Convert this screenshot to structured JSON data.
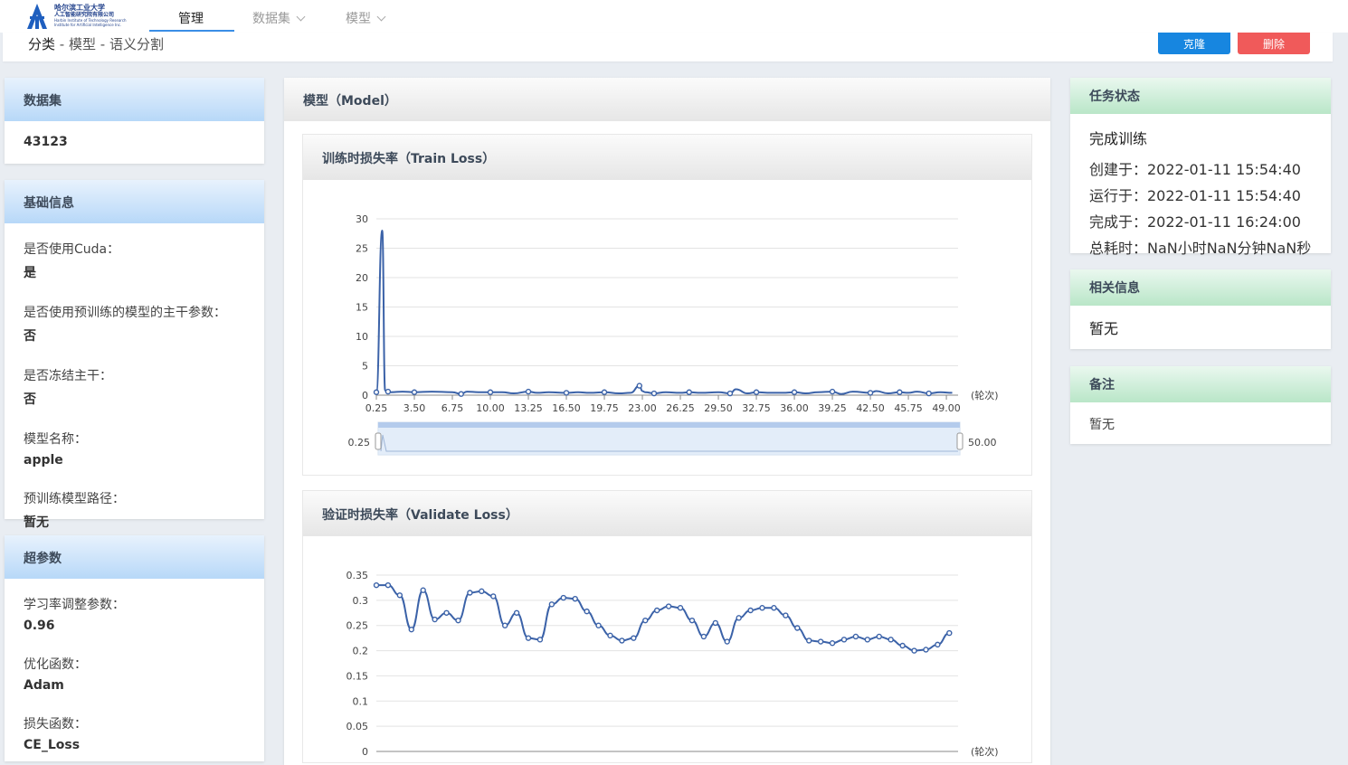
{
  "header": {
    "logo_line1": "哈尔滨工业大学",
    "logo_line2": "人工智能研究院有限公司",
    "logo_line3": "Harbin Institute of Technology Research",
    "logo_line4": "Institute for Artificial Intelligence Inc.",
    "nav": [
      {
        "label": "管理"
      },
      {
        "label": "数据集"
      },
      {
        "label": "模型"
      }
    ],
    "breadcrumb": {
      "root": "分类",
      "sep": " - ",
      "mid": "模型",
      "leaf": "语义分割"
    },
    "clone_label": "克隆",
    "delete_label": "删除"
  },
  "left": {
    "dataset": {
      "title": "数据集",
      "value": "43123"
    },
    "basic": {
      "title": "基础信息",
      "items": [
        {
          "label": "是否使用Cuda：",
          "value": "是"
        },
        {
          "label": "是否使用预训练的模型的主干参数：",
          "value": "否"
        },
        {
          "label": "是否冻结主干：",
          "value": "否"
        },
        {
          "label": "模型名称：",
          "value": "apple"
        },
        {
          "label": "预训练模型路径：",
          "value": "暂无"
        }
      ]
    },
    "hyper": {
      "title": "超参数",
      "items": [
        {
          "label": "学习率调整参数：",
          "value": "0.96"
        },
        {
          "label": "优化函数：",
          "value": "Adam"
        },
        {
          "label": "损失函数：",
          "value": "CE_Loss"
        }
      ]
    }
  },
  "middle": {
    "title": "模型（Model）",
    "train_title": "训练时损失率（Train Loss）",
    "val_title": "验证时损失率（Validate Loss）",
    "zoom_start": "0.25",
    "zoom_end": "50.00"
  },
  "right": {
    "status": {
      "title": "任务状态",
      "state": "完成训练",
      "lines": [
        "创建于：2022-01-11 15:54:40",
        "运行于：2022-01-11 15:54:40",
        "完成于：2022-01-11 16:24:00",
        "总耗时：NaN小时NaN分钟NaN秒"
      ]
    },
    "related": {
      "title": "相关信息",
      "value": "暂无"
    },
    "notes": {
      "title": "备注",
      "value": "暂无"
    }
  },
  "colors": {
    "accent": "#1786e0",
    "danger": "#f05a5a",
    "series": "#3b62a8"
  },
  "chart_data": [
    {
      "type": "line",
      "title": "训练时损失率（Train Loss）",
      "xlabel": "(轮次)",
      "ylabel": "",
      "ylim": [
        0,
        30
      ],
      "yticks": [
        0,
        5,
        10,
        15,
        20,
        25,
        30
      ],
      "xticks": [
        "0.25",
        "3.50",
        "6.75",
        "10.00",
        "13.25",
        "16.50",
        "19.75",
        "23.00",
        "26.25",
        "29.50",
        "32.75",
        "36.00",
        "39.25",
        "42.50",
        "45.75",
        "49.00"
      ],
      "xrange": [
        0.25,
        50
      ],
      "series": [
        {
          "x": [
            0.25,
            0.75,
            1.0,
            1.25,
            1.5,
            2.5,
            3.5,
            5,
            6.75,
            7.5,
            8,
            9,
            10,
            11,
            12,
            13.25,
            14,
            15,
            16.5,
            17.5,
            18.5,
            19.75,
            21,
            22,
            22.75,
            23,
            23.25,
            24,
            25,
            26.25,
            27,
            28,
            29.5,
            30.5,
            31,
            32,
            32.75,
            34,
            35,
            36,
            37,
            38,
            39.25,
            40,
            41,
            42.5,
            43,
            44,
            45,
            45.75,
            46.5,
            47.5,
            48.5,
            49.5
          ],
          "y": [
            0.5,
            28,
            0.8,
            0.6,
            0.5,
            0.6,
            0.5,
            0.6,
            0.5,
            0.2,
            0.6,
            0.5,
            0.5,
            0.5,
            0.3,
            0.6,
            0.4,
            0.5,
            0.4,
            0.5,
            0.4,
            0.5,
            0.3,
            0.4,
            1.6,
            0.7,
            0.5,
            0.3,
            0.5,
            0.4,
            0.5,
            0.4,
            0.5,
            0.3,
            1.0,
            0.3,
            0.5,
            0.4,
            0.4,
            0.5,
            0.3,
            0.5,
            0.6,
            0.2,
            0.6,
            0.4,
            0.7,
            0.3,
            0.5,
            0.4,
            0.6,
            0.3,
            0.5,
            0.4
          ]
        }
      ]
    },
    {
      "type": "line",
      "title": "验证时损失率（Validate Loss）",
      "xlabel": "(轮次)",
      "ylabel": "",
      "ylim": [
        0,
        0.35
      ],
      "yticks": [
        0,
        0.05,
        0.1,
        0.15,
        0.2,
        0.25,
        0.3,
        0.35
      ],
      "ytick_labels": [
        "0",
        "0.05",
        "0.1",
        "0.15",
        "0.2",
        "0.25",
        "0.3",
        "0.35"
      ],
      "xrange": [
        0.25,
        50
      ],
      "series": [
        {
          "x": [
            0.25,
            1.25,
            2.25,
            3.25,
            4.25,
            5.25,
            6.25,
            7.25,
            8.25,
            9.25,
            10.25,
            11.25,
            12.25,
            13.25,
            14.25,
            15.25,
            16.25,
            17.25,
            18.25,
            19.25,
            20.25,
            21.25,
            22.25,
            23.25,
            24.25,
            25.25,
            26.25,
            27.25,
            28.25,
            29.25,
            30.25,
            31.25,
            32.25,
            33.25,
            34.25,
            35.25,
            36.25,
            37.25,
            38.25,
            39.25,
            40.25,
            41.25,
            42.25,
            43.25,
            44.25,
            45.25,
            46.25,
            47.25,
            48.25,
            49.25
          ],
          "y": [
            0.33,
            0.33,
            0.31,
            0.242,
            0.32,
            0.262,
            0.275,
            0.26,
            0.315,
            0.318,
            0.308,
            0.25,
            0.275,
            0.225,
            0.222,
            0.292,
            0.305,
            0.303,
            0.278,
            0.25,
            0.23,
            0.22,
            0.225,
            0.26,
            0.28,
            0.288,
            0.285,
            0.26,
            0.228,
            0.255,
            0.218,
            0.265,
            0.28,
            0.285,
            0.285,
            0.27,
            0.245,
            0.22,
            0.218,
            0.215,
            0.222,
            0.228,
            0.222,
            0.228,
            0.222,
            0.21,
            0.2,
            0.202,
            0.212,
            0.235
          ]
        }
      ]
    }
  ]
}
